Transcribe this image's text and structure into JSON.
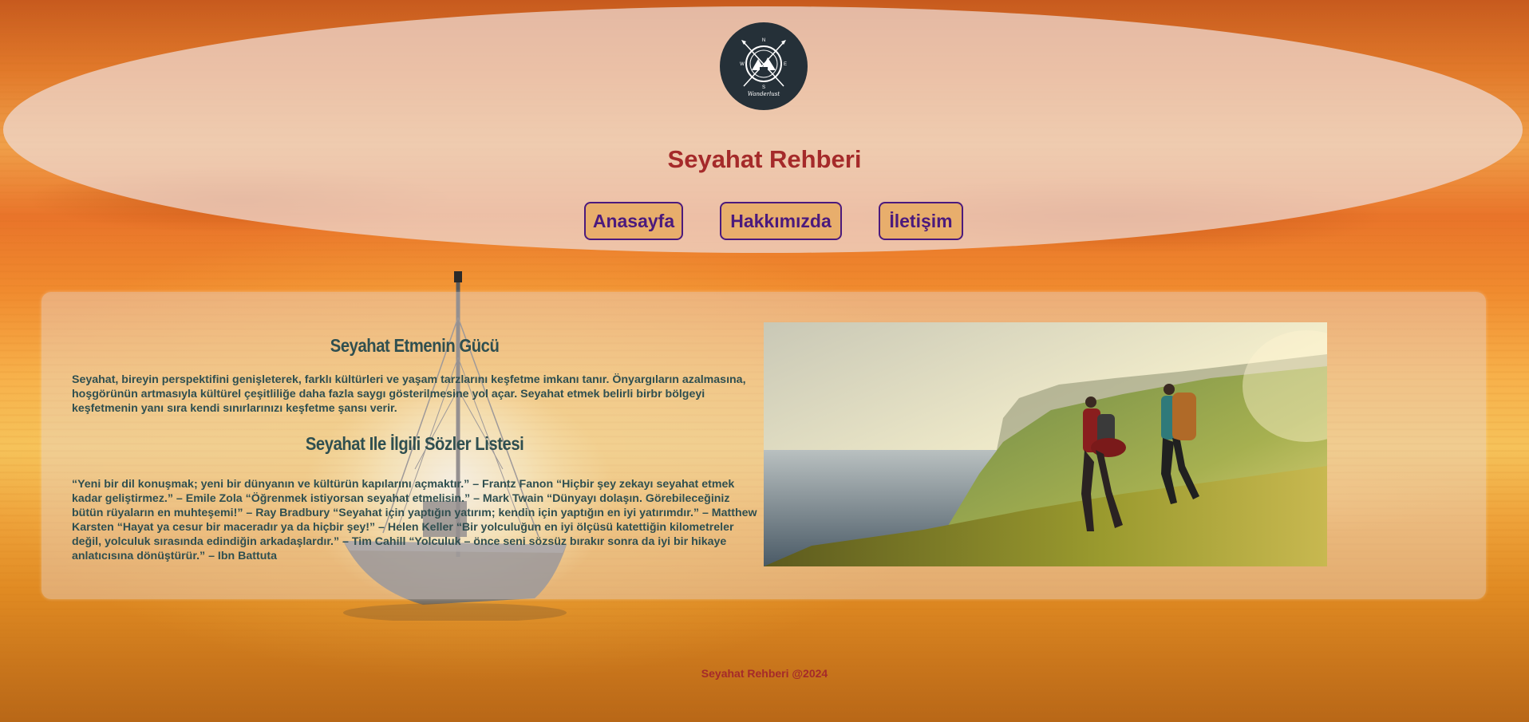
{
  "header": {
    "logo_text": "Wanderlust",
    "title": "Seyahat Rehberi",
    "nav": [
      {
        "label": "Anasayfa"
      },
      {
        "label": "Hakkımızda"
      },
      {
        "label": "İletişim"
      }
    ]
  },
  "main": {
    "section1_title": "Seyahat Etmenin Gücü",
    "section1_text": "Seyahat, bireyin perspektifini genişleterek, farklı kültürleri ve yaşam tarzlarını keşfetme imkanı tanır. Önyargıların azalmasına, hoşgörünün artmasıyla kültürel çeşitliliğe daha fazla saygı gösterilmesine yol açar. Seyahat etmek belirli birbr bölgeyi keşfetmenin yanı sıra kendi sınırlarınızı keşfetme şansı verir.",
    "section2_title": "Seyahat Ile İlgili Sözler Listesi",
    "section2_text": "“Yeni bir dil konuşmak; yeni bir dünyanın ve kültürün kapılarını açmaktır.” – Frantz Fanon “Hiçbir şey zekayı seyahat etmek kadar geliştirmez.” – Emile Zola “Öğrenmek istiyorsan seyahat etmelisin.” – Mark Twain “Dünyayı dolaşın. Görebileceğiniz bütün rüyaların en muhteşemi!” – Ray Bradbury “Seyahat için yaptığın yatırım; kendin için yaptığın en iyi yatırımdır.” – Matthew Karsten “Hayat ya cesur bir maceradır ya da hiçbir şey!” – Helen Keller “Bir yolculuğun en iyi ölçüsü katettiğin kilometreler değil, yolculuk sırasında edindiğin arkadaşlardır.” – Tim Cahill “Yolculuk – önce seni sözsüz bırakır sonra da iyi bir hikaye anlatıcısına dönüştürür.” – Ibn Battuta"
  },
  "footer": {
    "text": "Seyahat Rehberi @2024"
  },
  "colors": {
    "title": "#a52a2a",
    "nav_bg": "#e8ae6c",
    "nav_text": "#4b1a7d",
    "body_text": "#2f4f50",
    "logo_bg": "#253038"
  },
  "icons": {
    "logo": "compass-logo-icon",
    "hero": "hikers-coast-photo"
  }
}
